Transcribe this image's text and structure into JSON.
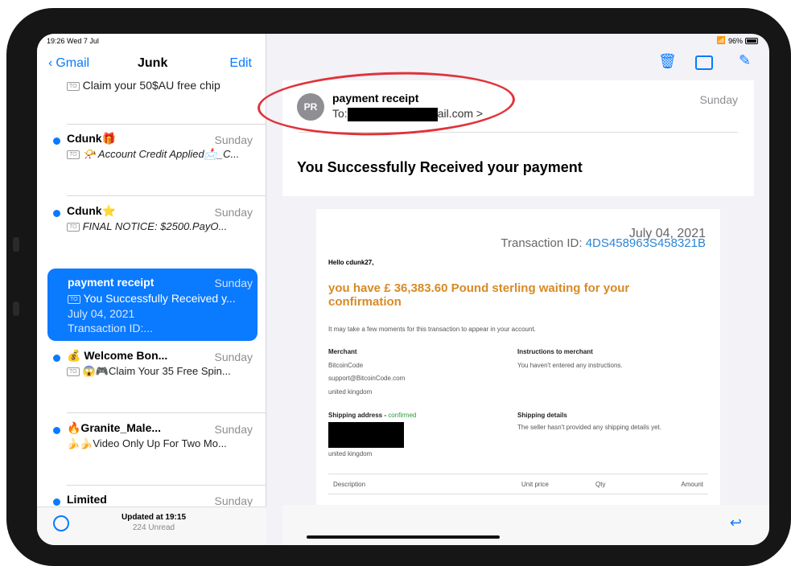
{
  "status": {
    "time": "19:26  Wed 7 Jul",
    "battery": "96%"
  },
  "nav": {
    "back": "Gmail",
    "title": "Junk",
    "edit": "Edit"
  },
  "list": {
    "partial_subject": "Claim your 50$AU free chip",
    "items": [
      {
        "from": "Cdunk🎁",
        "date": "Sunday",
        "subject": "📯 Account Credit Applied📩_C..."
      },
      {
        "from": "Cdunk⭐",
        "date": "Sunday",
        "subject": "FINAL NOTICE: $2500.PayO..."
      },
      {
        "from": "💰 Welcome Bon...",
        "date": "Sunday",
        "subject": "😱🎮Claim Your 35 Free Spin..."
      },
      {
        "from": "🔥Granite_Male...",
        "date": "Sunday",
        "subject": "🍌🍌Video Only Up For Two Mo..."
      },
      {
        "from": "Limited",
        "date": "Sunday",
        "subject": ""
      }
    ],
    "selected": {
      "from": "payment receipt",
      "date": "Sunday",
      "line1": "You Successfully Received y...",
      "line2": "July 04, 2021",
      "line3": "Transaction ID:..."
    },
    "tag": "TO"
  },
  "footer": {
    "updated": "Updated at 19:15",
    "unread": "224 Unread"
  },
  "message": {
    "avatar": "PR",
    "sender": "payment receipt",
    "to_prefix": "To:",
    "to_suffix": "ail.com >",
    "date": "Sunday",
    "subject": "You Successfully Received your payment"
  },
  "receipt": {
    "date": "July 04, 2021",
    "tx_label": "Transaction ID:",
    "tx_id": "4DS458963S458321B",
    "hello": "Hello cdunk27,",
    "headline": "you have £ 36,383.60 Pound sterling waiting for your confirmation",
    "note": "It may take a few moments for this transaction to appear in your account.",
    "merchant_label": "Merchant",
    "merchant_name": "BitcoinCode",
    "merchant_email": "support@BitcoinCode.com",
    "merchant_country": "united kingdom",
    "instructions_label": "Instructions to merchant",
    "instructions": "You haven't entered any instructions.",
    "shipping_label": "Shipping address - ",
    "shipping_status": "confirmed",
    "shipping_country": "united kingdom",
    "shipping_details_label": "Shipping details",
    "shipping_details": "The seller hasn't provided any shipping details yet.",
    "columns": [
      "Description",
      "Unit price",
      "Qty",
      "Amount"
    ]
  },
  "colors": {
    "accent": "#0a7aff",
    "highlight": "#d88a24",
    "annotation": "#e0333a"
  }
}
